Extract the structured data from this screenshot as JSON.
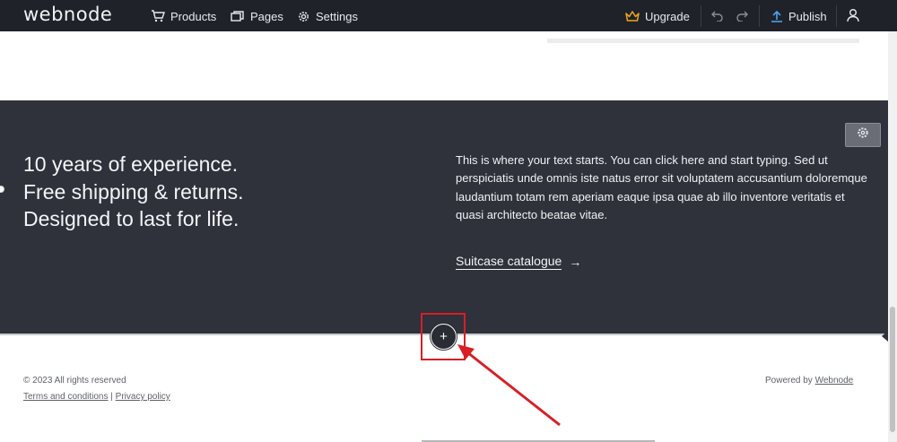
{
  "topbar": {
    "logo": "webnode",
    "nav": {
      "products": "Products",
      "pages": "Pages",
      "settings": "Settings",
      "upgrade": "Upgrade",
      "publish": "Publish"
    },
    "icons": [
      "cart-icon",
      "pages-icon",
      "gear-icon",
      "crown-icon",
      "undo-icon",
      "redo-icon",
      "upload-icon",
      "user-icon"
    ],
    "accent": "#f0a820"
  },
  "section": {
    "headline": [
      "10 years of experience.",
      "Free shipping & returns.",
      "Designed to last for life."
    ],
    "paragraph": "This is where your text starts. You can click here and start typing. Sed ut perspiciatis unde omnis iste natus error sit voluptatem accusantium doloremque laudantium totam rem aperiam eaque ipsa quae ab illo inventore veritatis et quasi architecto beatae vitae.",
    "link_label": "Suitcase catalogue",
    "link_arrow": "→",
    "background": "#2f313b"
  },
  "add_button": {
    "symbol": "+"
  },
  "annotation": {
    "color": "#d81f26"
  },
  "footer": {
    "copyright": "© 2023 All rights reserved",
    "terms": "Terms and conditions",
    "separator": "|",
    "privacy": "Privacy policy",
    "powered_prefix": "Powered by",
    "powered_link": "Webnode"
  }
}
